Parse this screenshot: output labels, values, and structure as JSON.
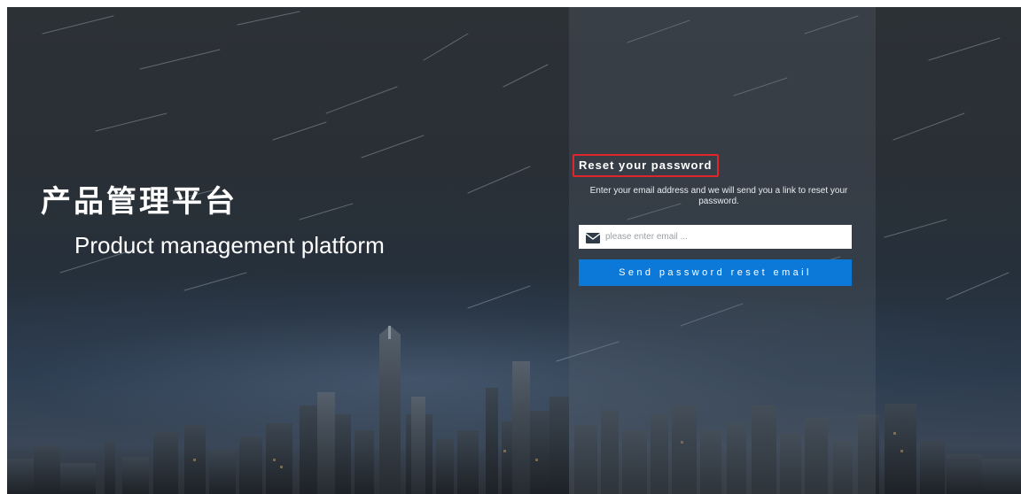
{
  "brand": {
    "title_cn": "产品管理平台",
    "title_en": "Product management platform"
  },
  "reset": {
    "title": "Reset your password",
    "description": "Enter your email address and we will send you a link to reset your password.",
    "email_placeholder": "please enter email ...",
    "email_value": "",
    "send_button_label": "Send password reset email"
  },
  "icons": {
    "email": "envelope-icon"
  },
  "colors": {
    "accent_button": "#0c79d8",
    "highlight_border": "#e0262a",
    "panel_overlay": "#5a6470"
  }
}
